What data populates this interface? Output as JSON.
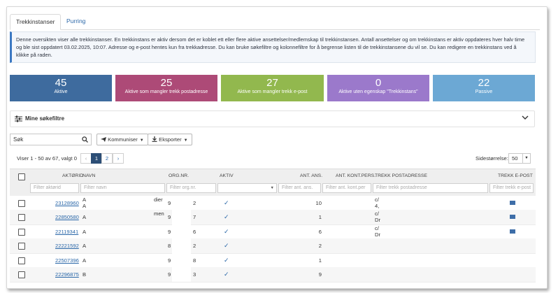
{
  "tabs": [
    "Trekkinstanser",
    "Purring"
  ],
  "info": "Denne oversikten viser alle trekkinstanser. En trekkinstans er aktiv dersom det er koblet ett eller flere aktive ansettelser/medlemskap til trekkinstansen. Antall ansettelser og om trekkinstans er aktiv oppdateres hver halv time og ble sist oppdatert 03.02.2025, 10:07. Adresse og e-post hentes kun fra trekkadresse. Du kan bruke søkefiltre og kolonnefiltre for å begrense listen til de trekkinstansene du vil se. Du kan redigere en trekkinstans ved å klikke på raden.",
  "cards": [
    {
      "value": "45",
      "label": "Aktive",
      "color": "#3e6b9e"
    },
    {
      "value": "25",
      "label": "Aktive som mangler trekk postadresse",
      "color": "#ad4a77"
    },
    {
      "value": "27",
      "label": "Aktive som mangler trekk e-post",
      "color": "#92b84e"
    },
    {
      "value": "0",
      "label": "Aktive uten egenskap \"Trekkinstans\"",
      "color": "#9b79cb"
    },
    {
      "value": "22",
      "label": "Passive",
      "color": "#6ca8d4"
    }
  ],
  "filters": {
    "title": "Mine søkefiltre"
  },
  "search": {
    "value": "Søk"
  },
  "buttons": {
    "kommuniser": "Kommuniser",
    "eksporter": "Eksporter"
  },
  "pagination": {
    "info": "Viser 1 - 50 av 67, valgt 0",
    "prev": "‹",
    "pages": [
      "1",
      "2"
    ],
    "next": "›",
    "size_label": "Sidestørrelse:",
    "size": "50"
  },
  "columns": {
    "aktorid": "AKTØRID",
    "navn": "NAVN",
    "orgnr": "ORG.NR.",
    "aktiv": "AKTIV",
    "ant_ans": "ANT. ANS.",
    "ant_kont": "ANT. KONT.PERS.",
    "postadresse": "TREKK POSTADRESSE",
    "epost": "TREKK E-POST"
  },
  "column_filters": {
    "aktorid": "Filter aktørid",
    "navn": "Filter navn",
    "orgnr": "Filter org.nr.",
    "ant_ans": "Filter ant. ans.",
    "ant_kont": "Filter ant. kont.per",
    "postadresse": "Filter trekk postadresse",
    "epost": "Filter trekk e-post"
  },
  "rows": [
    {
      "id": "23128960",
      "navn1": "A",
      "navn2": "A",
      "navnx": "dier",
      "org1": "9",
      "org2": "2",
      "aktiv": true,
      "ant": "10",
      "adr1": "c/",
      "adr2": "4,",
      "mail": true
    },
    {
      "id": "22850580",
      "navn1": "A",
      "navn2": "",
      "navnx": "men",
      "org1": "9",
      "org2": "7",
      "aktiv": true,
      "ant": "1",
      "adr1": "c/",
      "adr2": "Dr",
      "mail": true
    },
    {
      "id": "22119341",
      "navn1": "A",
      "navn2": "",
      "navnx": "",
      "org1": "9",
      "org2": "6",
      "aktiv": true,
      "ant": "6",
      "adr1": "c/",
      "adr2": "Dr",
      "mail": true
    },
    {
      "id": "22221592",
      "navn1": "A",
      "navn2": "",
      "navnx": "",
      "org1": "8",
      "org2": "2",
      "aktiv": true,
      "ant": "2",
      "adr1": "",
      "adr2": "",
      "mail": false
    },
    {
      "id": "22507396",
      "navn1": "A",
      "navn2": "",
      "navnx": "",
      "org1": "9",
      "org2": "8",
      "aktiv": true,
      "ant": "1",
      "adr1": "",
      "adr2": "",
      "mail": false
    },
    {
      "id": "22296875",
      "navn1": "B",
      "navn2": "",
      "navnx": "",
      "org1": "9",
      "org2": "3",
      "aktiv": true,
      "ant": "9",
      "adr1": "",
      "adr2": "",
      "mail": false
    }
  ],
  "check_glyph": "✓"
}
